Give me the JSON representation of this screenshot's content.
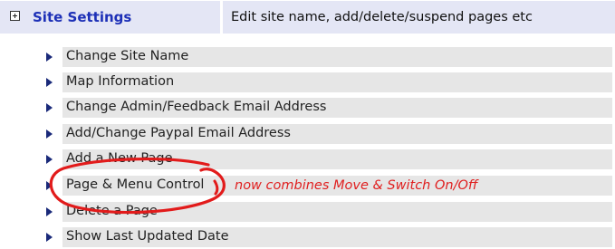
{
  "header": {
    "expand_icon": "plus-box-icon",
    "title": "Site Settings",
    "description": "Edit site name, add/delete/suspend pages etc"
  },
  "menu": {
    "items": [
      {
        "label": "Change Site Name"
      },
      {
        "label": "Map Information"
      },
      {
        "label": "Change Admin/Feedback Email Address"
      },
      {
        "label": "Add/Change Paypal Email Address"
      },
      {
        "label": "Add a New Page"
      },
      {
        "label": "Page & Menu Control"
      },
      {
        "label": "Delete a Page"
      },
      {
        "label": "Show Last Updated Date"
      }
    ]
  },
  "annotation": {
    "text": "now combines Move & Switch On/Off",
    "color": "#e02020"
  },
  "colors": {
    "header_bg": "#e4e6f5",
    "title": "#1d30b7",
    "row_bg": "#e6e6e6",
    "arrow": "#1a2a7a"
  }
}
